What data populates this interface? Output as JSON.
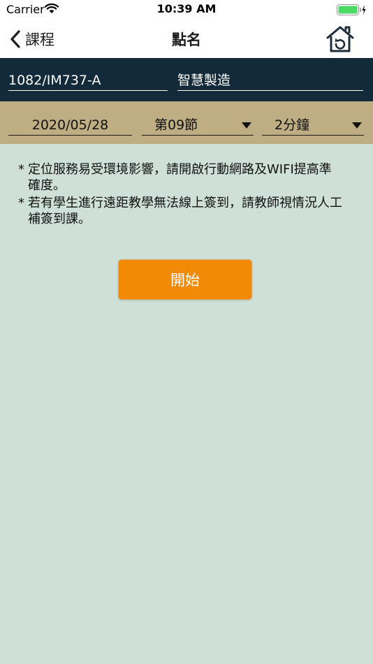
{
  "status_bar": {
    "carrier": "Carrier",
    "time": "10:39 AM"
  },
  "nav": {
    "back_label": "課程",
    "title": "點名",
    "home_icon": "home-refresh-icon"
  },
  "course": {
    "code": "1082/IM737-A",
    "name": "智慧製造"
  },
  "session": {
    "date": "2020/05/28",
    "period": "第09節",
    "duration": "2分鐘"
  },
  "notes": [
    {
      "bullet": "*",
      "text": "定位服務易受環境影響，請開啟行動網路及WIFI提高準確度。"
    },
    {
      "bullet": "*",
      "text": "若有學生進行遠距教學無法線上簽到，請教師視情況人工補簽到課。"
    }
  ],
  "actions": {
    "start_label": "開始"
  },
  "colors": {
    "course_band": "#132a3a",
    "session_band": "#bfae83",
    "content_bg": "#cfe0d9",
    "accent": "#f28a05",
    "battery": "#4cd964"
  }
}
